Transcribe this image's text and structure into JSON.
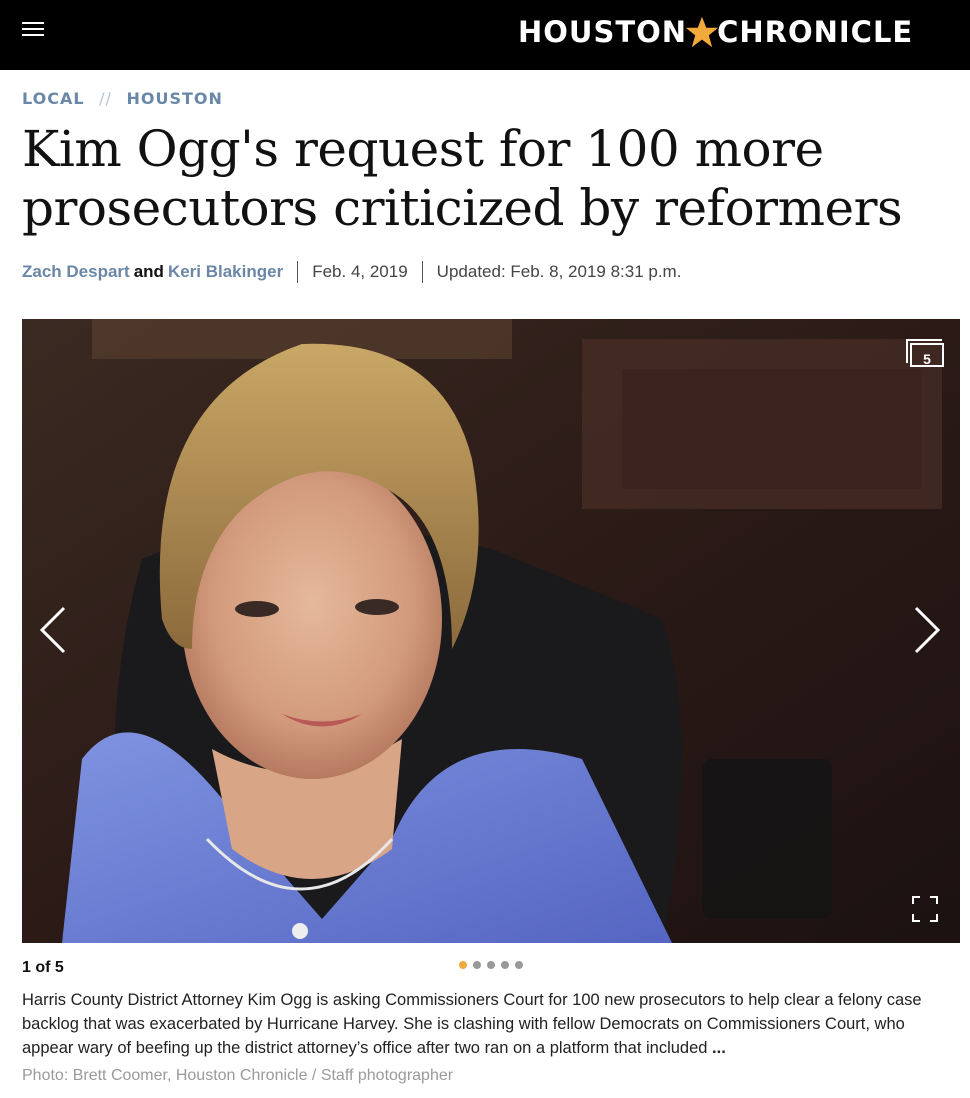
{
  "header": {
    "logo_left": "HOUSTON",
    "logo_right": "CHRONICLE",
    "colors": {
      "bar": "#000000",
      "star": "#f2a93b"
    }
  },
  "breadcrumb": {
    "section": "LOCAL",
    "separator": "//",
    "subsection": "HOUSTON"
  },
  "article": {
    "headline": "Kim Ogg's request for 100 more prosecutors criticized by reformers",
    "author_1": "Zach Despart",
    "author_join": "and",
    "author_2": "Keri Blakinger",
    "published": "Feb. 4, 2019",
    "updated": "Updated: Feb. 8, 2019 8:31 p.m."
  },
  "gallery": {
    "photo_count_badge": "5",
    "counter": "1 of 5",
    "current_index": 1,
    "total": 5,
    "dots": [
      true,
      false,
      false,
      false,
      false
    ],
    "prev_icon": "chevron-left-icon",
    "next_icon": "chevron-right-icon",
    "expand_icon": "fullscreen-icon",
    "caption": "Harris County District Attorney Kim Ogg is asking Commissioners Court for 100 new prosecutors to help clear a felony case backlog that was exacerbated by Hurricane Harvey. She is clashing with fellow Democrats on Commissioners Court, who appear wary of beefing up the district attorney’s office after two ran on a platform that included",
    "caption_more": "...",
    "credit": "Photo: Brett Coomer, Houston Chronicle / Staff photographer"
  },
  "colors": {
    "link": "#6a87a8",
    "active_dot": "#f2a93b",
    "inactive_dot": "#999999"
  }
}
